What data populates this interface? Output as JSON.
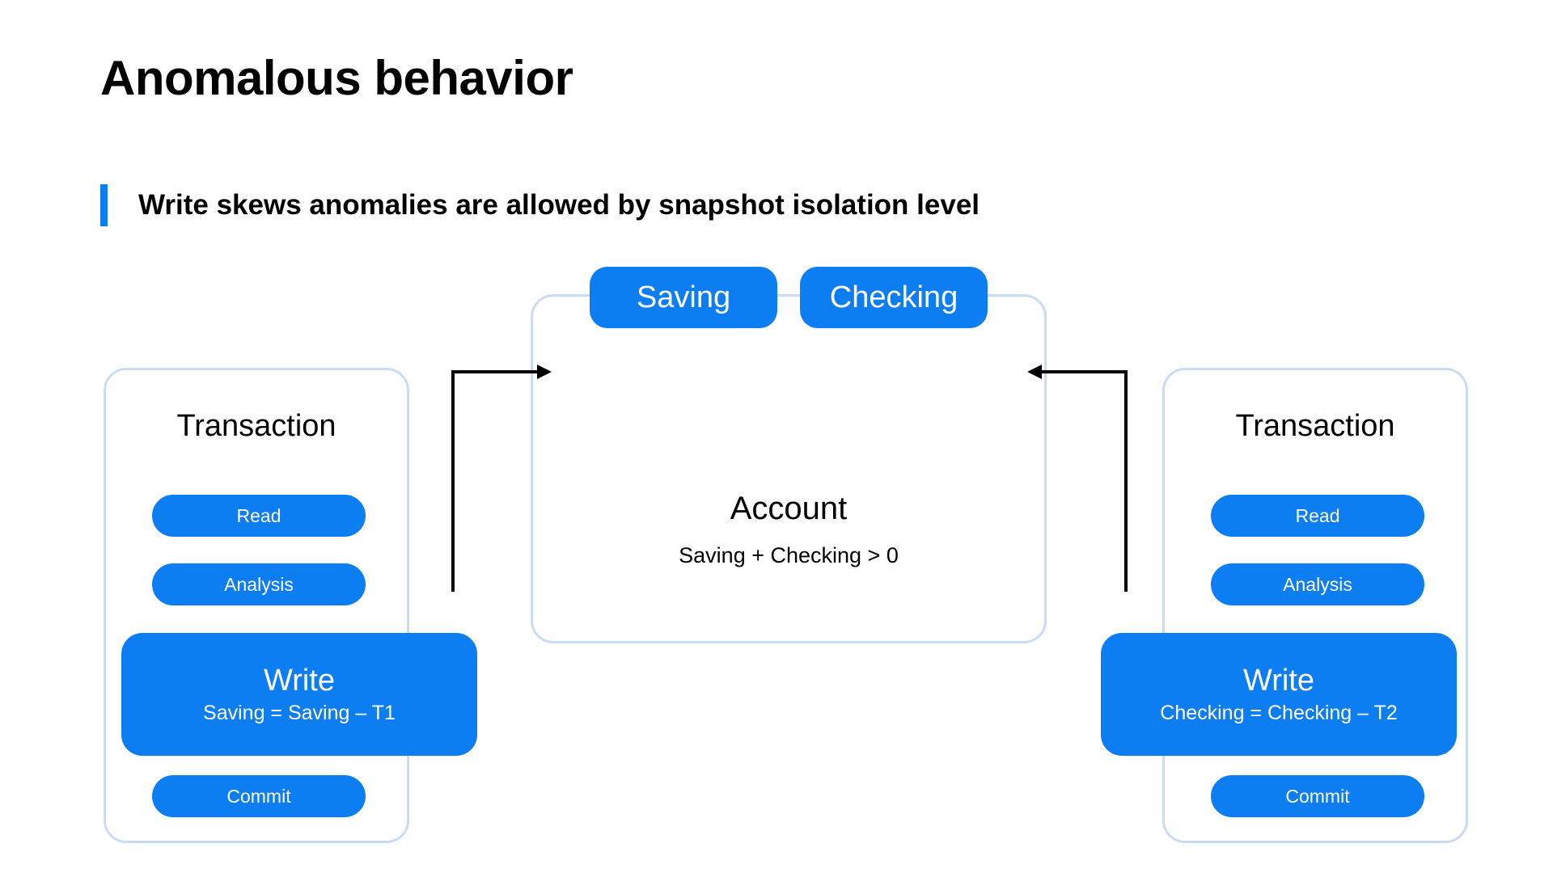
{
  "slide": {
    "title": "Anomalous behavior",
    "subtitle": "Write skews anomalies are allowed by snapshot isolation level",
    "accent_color": "#0d7df2",
    "panel_border_color": "#c9dcf3",
    "text_color": "#000000",
    "background_color": "#ffffff"
  },
  "left_transaction": {
    "title": "Transaction",
    "read_label": "Read",
    "analysis_label": "Analysis",
    "write_title": "Write",
    "write_formula": "Saving = Saving – T1",
    "commit_label": "Commit"
  },
  "right_transaction": {
    "title": "Transaction",
    "read_label": "Read",
    "analysis_label": "Analysis",
    "write_title": "Write",
    "write_formula": "Checking = Checking – T2",
    "commit_label": "Commit"
  },
  "account": {
    "saving_label": "Saving",
    "checking_label": "Checking",
    "title": "Account",
    "invariant": "Saving + Checking > 0"
  },
  "connectors": {
    "left_arrow": "arrow-right-icon",
    "right_arrow": "arrow-left-icon"
  }
}
